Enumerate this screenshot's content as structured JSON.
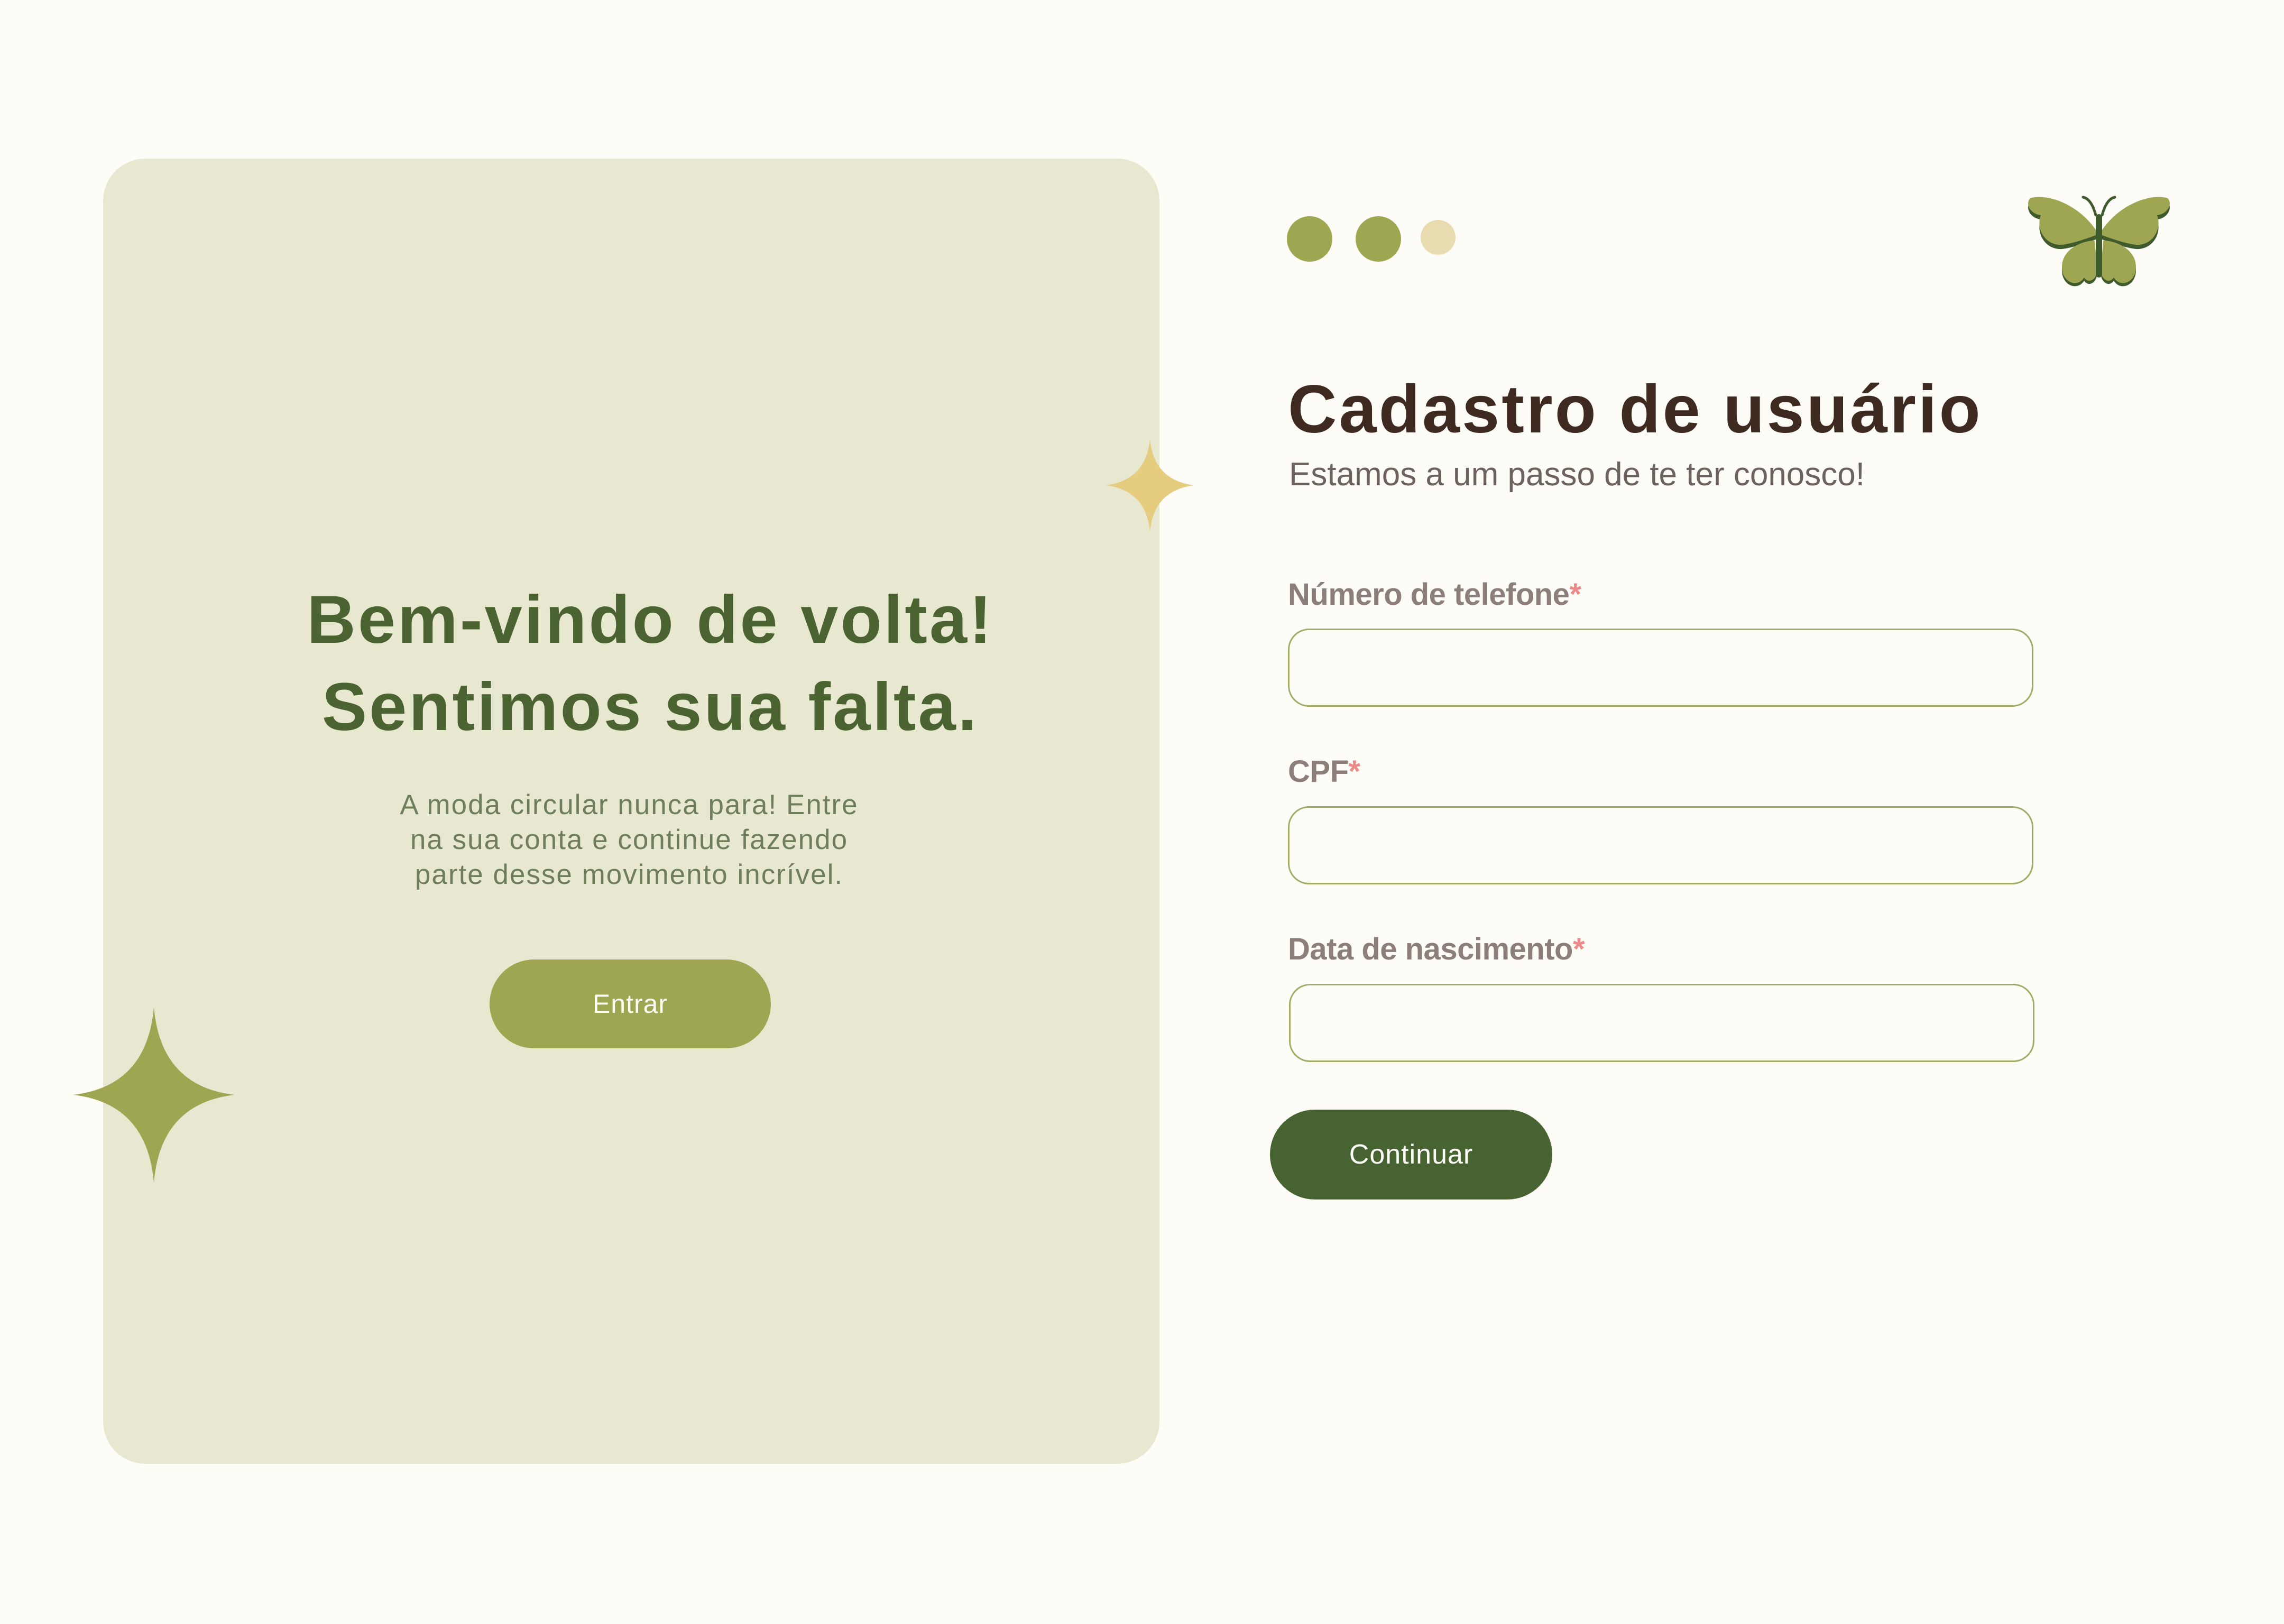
{
  "welcome": {
    "title_line1": "Bem-vindo de volta!",
    "title_line2": "Sentimos sua falta.",
    "text_line1": "A moda circular nunca para! Entre",
    "text_line2": "na sua conta e continue fazendo",
    "text_line3": "parte desse movimento incrível.",
    "enter_label": "Entrar"
  },
  "steps": {
    "total": 3,
    "completed": 2
  },
  "form": {
    "title": "Cadastro de usuário",
    "subtitle": "Estamos a um passo de te ter conosco!",
    "fields": [
      {
        "label": "Número de telefone",
        "required_mark": "*",
        "value": "",
        "placeholder": ""
      },
      {
        "label": "CPF",
        "required_mark": "*",
        "value": "",
        "placeholder": ""
      },
      {
        "label": "Data de nascimento",
        "required_mark": "*",
        "value": "",
        "placeholder": ""
      }
    ],
    "continue_label": "Continuar"
  },
  "icons": [
    "sparkle-icon",
    "butterfly-icon"
  ],
  "colors": {
    "background": "#fdfcf7",
    "panel": "#e8e8d0",
    "olive": "#9ea651",
    "dark_green": "#476331",
    "gold": "#e6cc7f",
    "brown": "#3e2a20",
    "required": "#ec8a8a"
  }
}
